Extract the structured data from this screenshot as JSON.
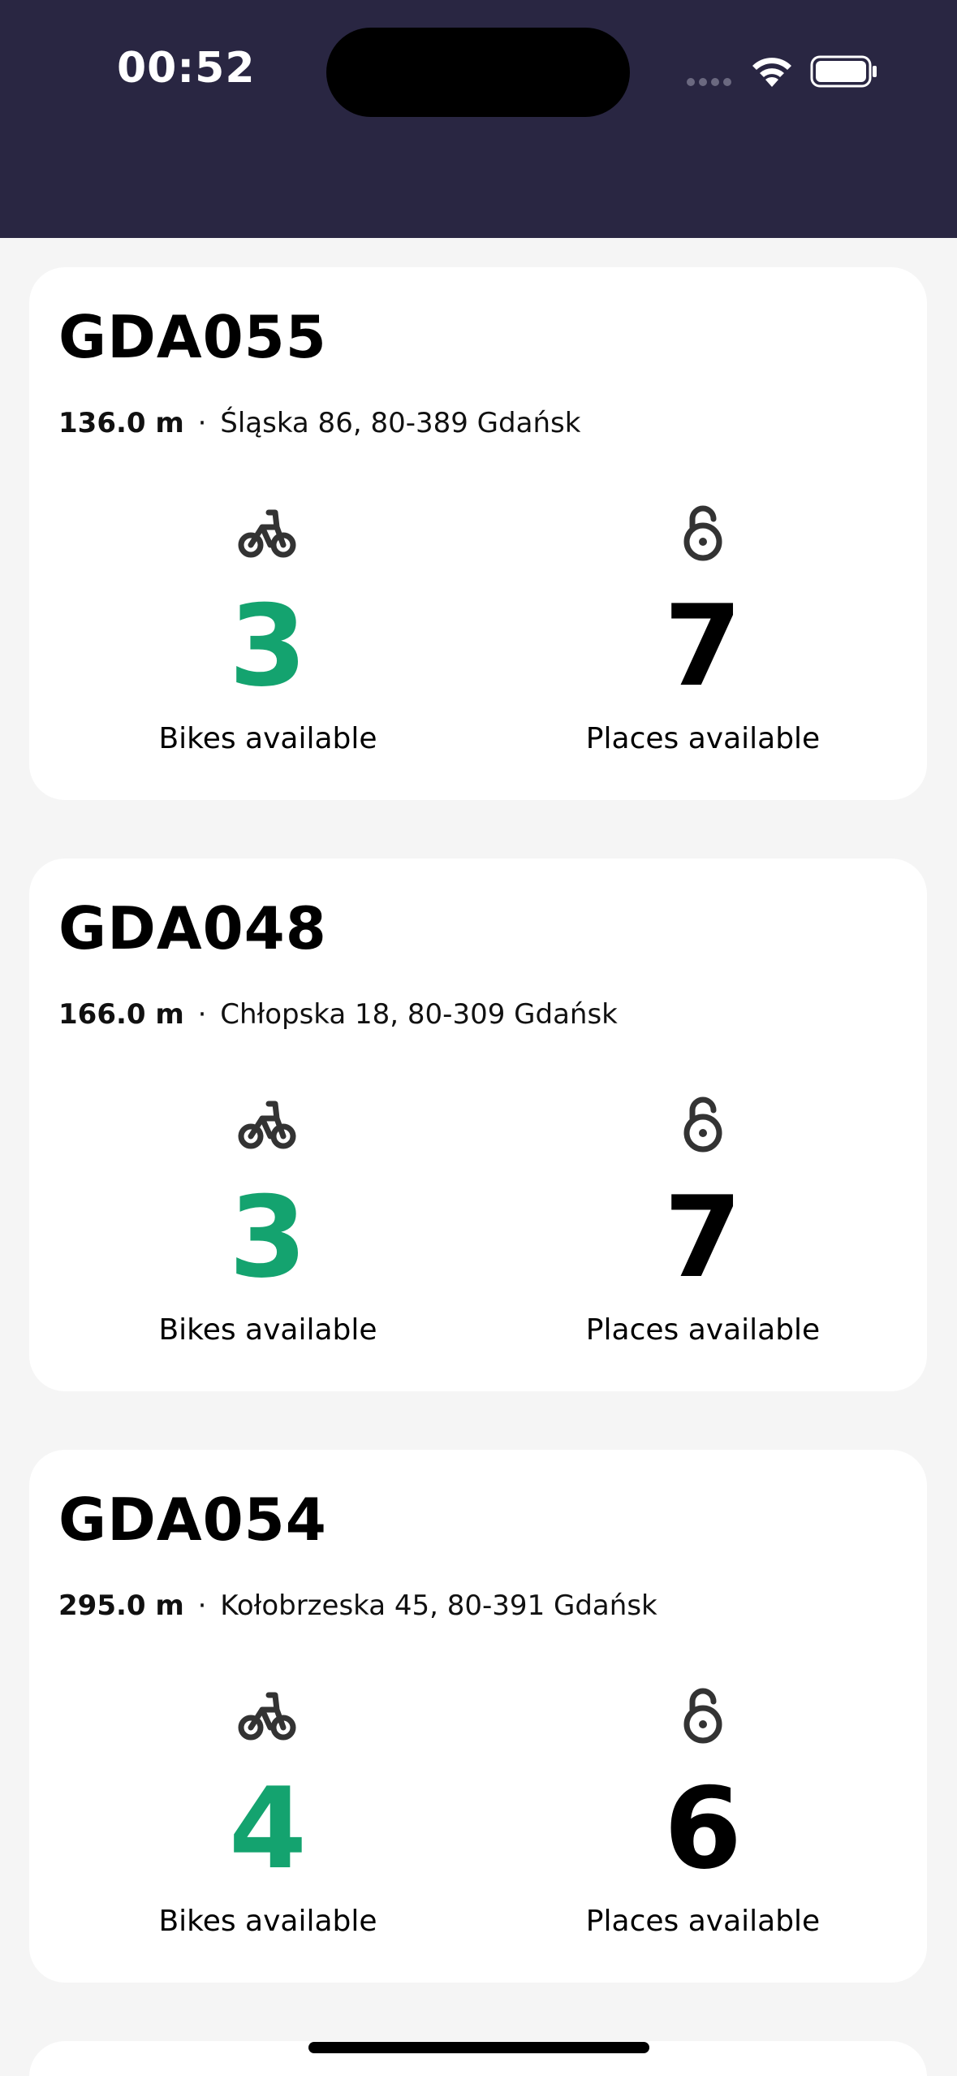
{
  "status_bar": {
    "time": "00:52"
  },
  "icons": {
    "bike": "bicycle-icon",
    "lock": "padlock-open-icon"
  },
  "colors": {
    "header_bg": "#292642",
    "bikes_accent": "#14a36f",
    "page_bg": "#f5f5f5"
  },
  "stations": [
    {
      "code": "GDA055",
      "distance": "136.0 m",
      "separator": "·",
      "address": "Śląska 86, 80-389 Gdańsk",
      "bikes": "3",
      "bikes_label": "Bikes available",
      "places": "7",
      "places_label": "Places available"
    },
    {
      "code": "GDA048",
      "distance": "166.0 m",
      "separator": "·",
      "address": "Chłopska 18, 80-309 Gdańsk",
      "bikes": "3",
      "bikes_label": "Bikes available",
      "places": "7",
      "places_label": "Places available"
    },
    {
      "code": "GDA054",
      "distance": "295.0 m",
      "separator": "·",
      "address": "Kołobrzeska 45, 80-391 Gdańsk",
      "bikes": "4",
      "bikes_label": "Bikes available",
      "places": "6",
      "places_label": "Places available"
    }
  ]
}
